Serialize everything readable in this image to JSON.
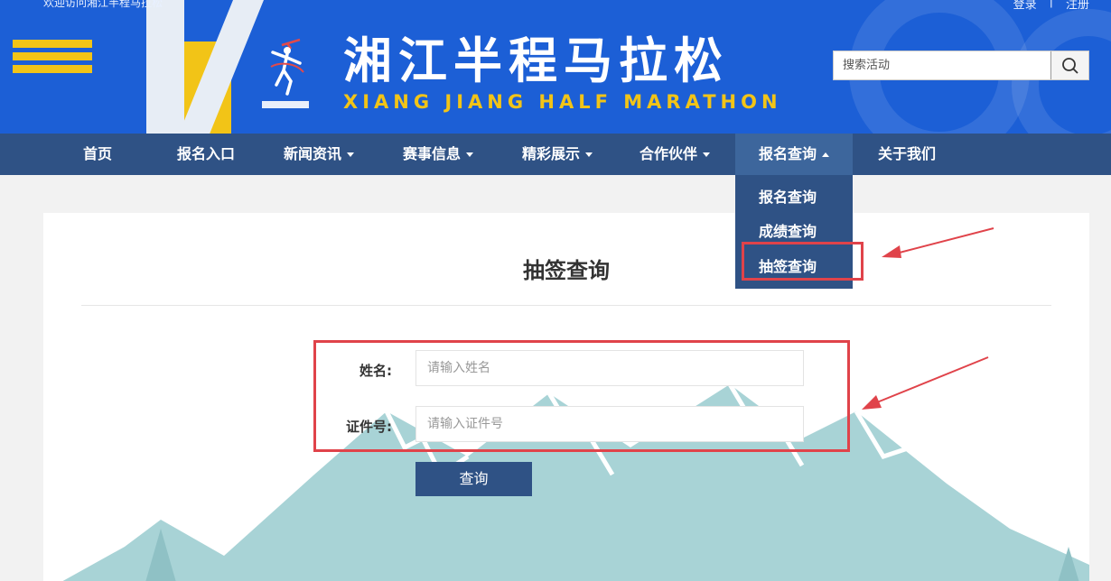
{
  "header": {
    "welcome": "欢迎访问湘江半程马拉松",
    "login": "登录",
    "separator": "|",
    "register": "注册",
    "title_cn": "湘江半程马拉松",
    "title_en": "XIANG JIANG HALF MARATHON",
    "search_placeholder": "搜索活动"
  },
  "nav": {
    "items": [
      {
        "label": "首页"
      },
      {
        "label": "报名入口"
      },
      {
        "label": "新闻资讯"
      },
      {
        "label": "赛事信息"
      },
      {
        "label": "精彩展示"
      },
      {
        "label": "合作伙伴"
      },
      {
        "label": "报名查询"
      },
      {
        "label": "关于我们"
      }
    ],
    "dropdown": [
      {
        "label": "报名查询"
      },
      {
        "label": "成绩查询"
      },
      {
        "label": "抽签查询"
      }
    ]
  },
  "main": {
    "title": "抽签查询",
    "name_label": "姓名:",
    "name_placeholder": "请输入姓名",
    "id_label": "证件号:",
    "id_placeholder": "请输入证件号",
    "query_button": "查询"
  },
  "colors": {
    "header_blue": "#1c5fd6",
    "nav_blue": "#2f5285",
    "accent_yellow": "#f2c417",
    "annotation_red": "#e0434a"
  }
}
